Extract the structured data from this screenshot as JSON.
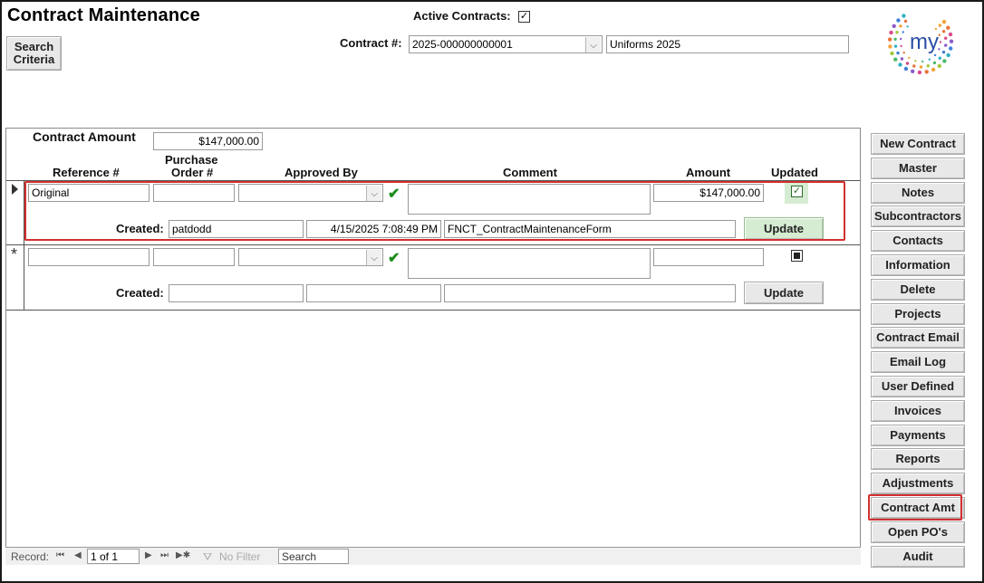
{
  "header": {
    "title": "Contract Maintenance",
    "search_criteria": "Search\nCriteria",
    "active_contracts_label": "Active Contracts:",
    "active_contracts_checked": true,
    "contract_label": "Contract #:",
    "contract_number": "2025-000000000001",
    "contract_name": "Uniforms 2025",
    "logo_text": "my"
  },
  "subform": {
    "contract_amount_label": "Contract Amount",
    "contract_amount": "$147,000.00",
    "columns": {
      "reference": "Reference #",
      "po_line1": "Purchase",
      "po_line2": "Order #",
      "approved_by": "Approved By",
      "comment": "Comment",
      "amount": "Amount",
      "updated": "Updated"
    },
    "rows": [
      {
        "reference": "Original",
        "po": "",
        "approved_by": "",
        "comment": "",
        "amount": "$147,000.00",
        "updated": true,
        "created_label": "Created:",
        "created_by": "patdodd",
        "created_at": "4/15/2025 7:08:49 PM",
        "created_source": "FNCT_ContractMaintenanceForm",
        "update_label": "Update"
      },
      {
        "reference": "",
        "po": "",
        "approved_by": "",
        "comment": "",
        "amount": "",
        "updated": false,
        "created_label": "Created:",
        "created_by": "",
        "created_at": "",
        "created_source": "",
        "update_label": "Update"
      }
    ],
    "record_indicator_new": "*"
  },
  "navigation": {
    "record_label": "Record:",
    "current": "1 of 1",
    "filter": "No Filter",
    "search": "Search"
  },
  "sidebar": {
    "buttons": [
      "New Contract",
      "Master",
      "Notes",
      "Subcontractors",
      "Contacts",
      "Information",
      "Delete",
      "Projects",
      "Contract Email",
      "Email Log",
      "User Defined",
      "Invoices",
      "Payments",
      "Reports",
      "Adjustments",
      "Contract Amt",
      "Open PO's",
      "Audit"
    ],
    "highlighted": "Contract Amt"
  },
  "colors": {
    "highlight": "#d32f2f",
    "update_active_bg": "#d6ecd2",
    "check_green": "#1c8c1c"
  }
}
